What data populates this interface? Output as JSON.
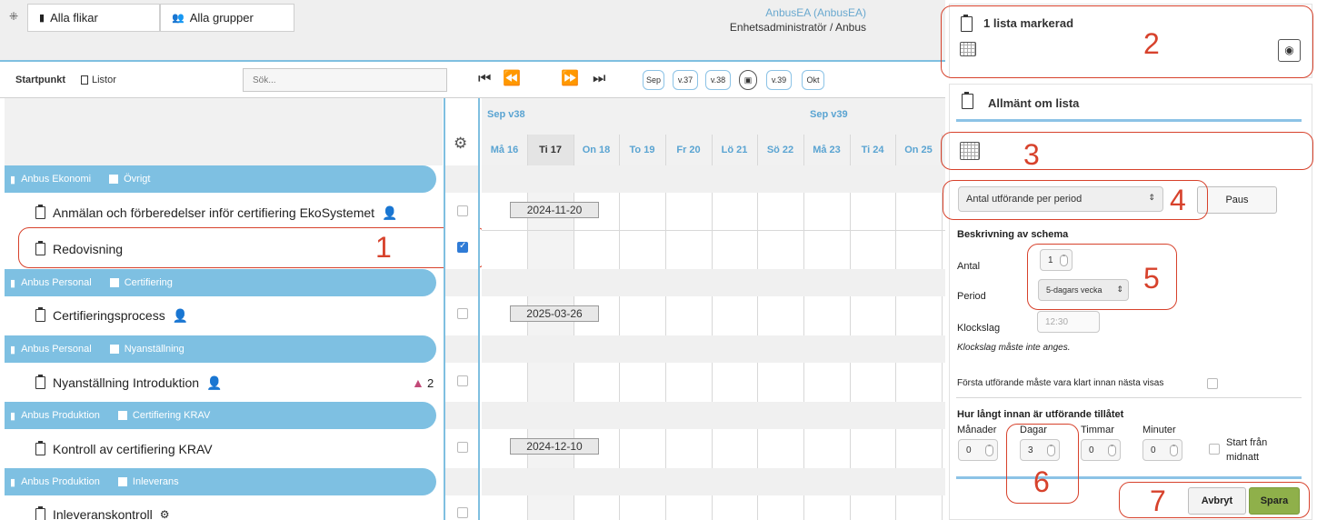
{
  "topbar": {
    "tab_button": "Alla flikar",
    "group_button": "Alla grupper",
    "user_name": "AnbusEA (AnbusEA)",
    "user_role": "Enhetsadministratör / Anbus"
  },
  "toolbar": {
    "startpoint_label": "Startpunkt",
    "lists_label": "Listor",
    "search_placeholder": "Sök...",
    "week_pills": [
      "Sep",
      "v.37",
      "v.38",
      "v.39",
      "Okt"
    ]
  },
  "calendar": {
    "weeks": [
      "Sep v38",
      "Sep v39"
    ],
    "days": [
      "Må 16",
      "Ti 17",
      "On 18",
      "To 19",
      "Fr 20",
      "Lö 21",
      "Sö 22",
      "Må 23",
      "Ti 24",
      "On 25"
    ]
  },
  "groups": [
    {
      "org": "Anbus Ekonomi",
      "category": "Övrigt"
    },
    {
      "org": "Anbus Personal",
      "category": "Certifiering"
    },
    {
      "org": "Anbus Personal",
      "category": "Nyanställning"
    },
    {
      "org": "Anbus Produktion",
      "category": "Certifiering KRAV"
    },
    {
      "org": "Anbus Produktion",
      "category": "Inleverans"
    }
  ],
  "lists": [
    {
      "title": "Anmälan och förberedelser inför certifiering EkoSystemet",
      "date": "2024-11-20",
      "checked": false
    },
    {
      "title": "Redovisning",
      "date": "",
      "checked": true
    },
    {
      "title": "Certifieringsprocess",
      "date": "2025-03-26",
      "checked": false
    },
    {
      "title": "Nyanställning Introduktion",
      "date": "",
      "checked": false,
      "warning_count": "2"
    },
    {
      "title": "Kontroll av certifiering KRAV",
      "date": "2024-12-10",
      "checked": false
    },
    {
      "title": "Inleveranskontroll",
      "date": "",
      "checked": false
    }
  ],
  "panel": {
    "selected_title": "1 lista markerad",
    "section_title": "Allmänt om lista",
    "mode_select": "Antal utförande per period",
    "pause_button": "Paus",
    "schedule_heading": "Beskrivning av schema",
    "count_label": "Antal",
    "count_value": "1",
    "period_label": "Period",
    "period_value": "5-dagars vecka",
    "time_label": "Klockslag",
    "time_value": "12:30",
    "time_note": "Klockslag måste inte anges.",
    "first_done_label": "Första utförande måste vara klart innan nästa visas",
    "allowed_heading": "Hur långt innan är utförande tillåtet",
    "months_label": "Månader",
    "months_value": "0",
    "days_label": "Dagar",
    "days_value": "3",
    "hours_label": "Timmar",
    "hours_value": "0",
    "minutes_label": "Minuter",
    "minutes_value": "0",
    "midnight_label_1": "Start från",
    "midnight_label_2": "midnatt",
    "cancel_button": "Avbryt",
    "save_button": "Spara"
  },
  "annotations": [
    "1",
    "2",
    "3",
    "4",
    "5",
    "6",
    "7"
  ],
  "colors": {
    "accent": "#7ec0e2",
    "annotation": "#d7422c",
    "save": "#8fb04a"
  }
}
